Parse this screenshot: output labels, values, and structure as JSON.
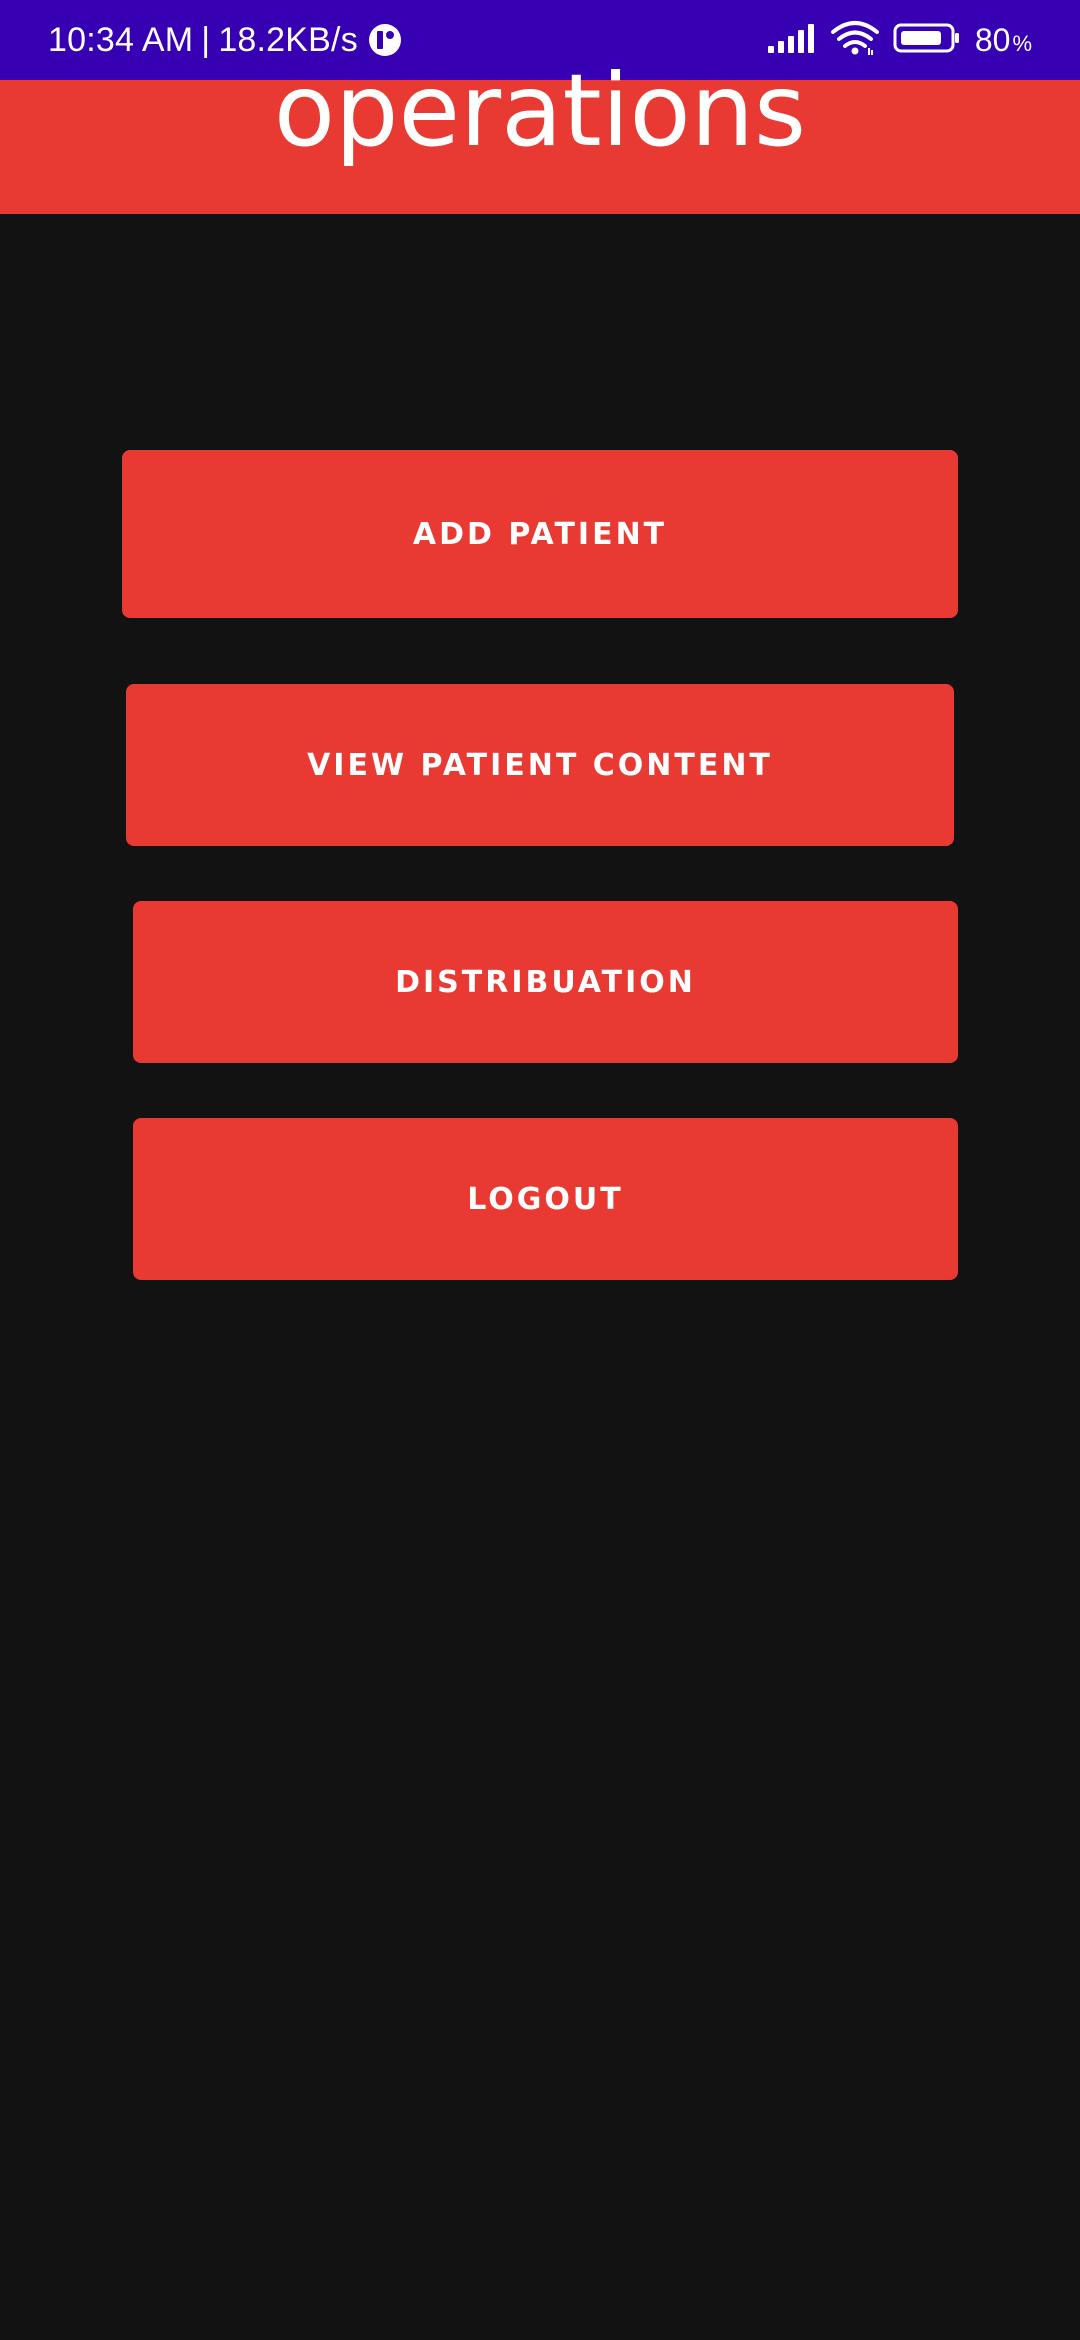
{
  "status_bar": {
    "time": "10:34 AM",
    "separator": "|",
    "network_speed": "18.2KB/s",
    "battery_level": "80",
    "battery_unit": "%",
    "icons": [
      "app-notification-icon",
      "signal-icon",
      "wifi-icon",
      "battery-icon"
    ],
    "background": "#3700b3"
  },
  "header": {
    "title": "operations",
    "background": "#e83a32"
  },
  "buttons": {
    "add_patient": "ADD PATIENT",
    "view_patient_content": "VIEW PATIENT CONTENT",
    "distribution": "DISTRIBUATION",
    "logout": "LOGOUT"
  },
  "colors": {
    "accent": "#e83a32",
    "background": "#121212",
    "text": "#ffffff"
  }
}
